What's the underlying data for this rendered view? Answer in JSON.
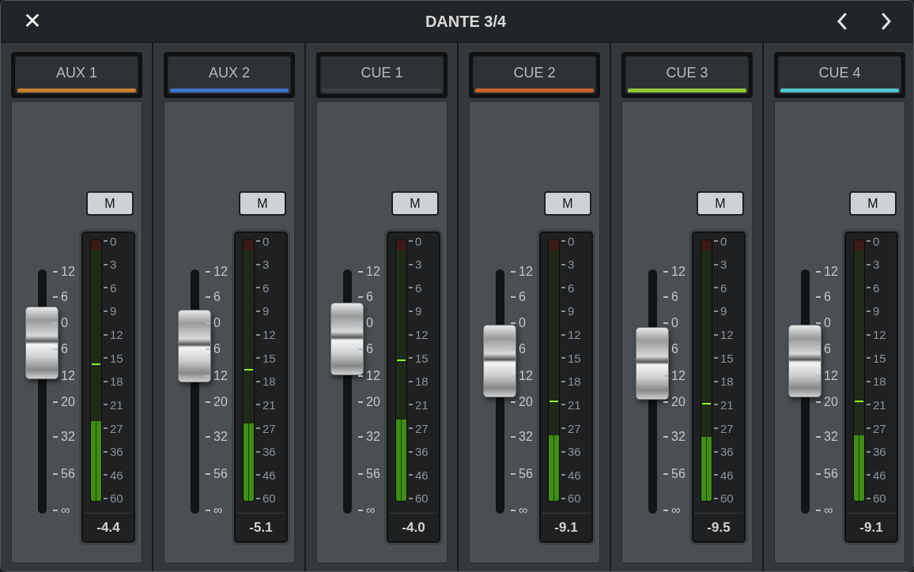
{
  "window": {
    "title": "DANTE 3/4",
    "close_icon": "✕"
  },
  "channels": [
    {
      "name": "AUX 1",
      "color": "#c4802f",
      "mute": {
        "label": "M",
        "muted": false
      },
      "fader": {
        "level": 0.7
      },
      "fader_scale": [
        "12",
        "6",
        "0",
        "6",
        "12",
        "20",
        "32",
        "56",
        "∞"
      ],
      "meter": {
        "level": 0.307
      },
      "peak": {
        "level": 0.52
      },
      "meter_scale": [
        "0",
        "3",
        "6",
        "9",
        "12",
        "15",
        "18",
        "21",
        "27",
        "36",
        "46",
        "60"
      ],
      "reading": "-4.4"
    },
    {
      "name": "AUX 2",
      "color": "#3a74c8",
      "mute": {
        "label": "M",
        "muted": false
      },
      "fader": {
        "level": 0.686
      },
      "fader_scale": [
        "12",
        "6",
        "0",
        "6",
        "12",
        "20",
        "32",
        "56",
        "∞"
      ],
      "meter": {
        "level": 0.298
      },
      "peak": {
        "level": 0.5
      },
      "meter_scale": [
        "0",
        "3",
        "6",
        "9",
        "12",
        "15",
        "18",
        "21",
        "27",
        "36",
        "46",
        "60"
      ],
      "reading": "-5.1"
    },
    {
      "name": "CUE 1",
      "color": "#3c3f42",
      "mute": {
        "label": "M",
        "muted": false
      },
      "fader": {
        "level": 0.715
      },
      "fader_scale": [
        "12",
        "6",
        "0",
        "6",
        "12",
        "20",
        "32",
        "56",
        "∞"
      ],
      "meter": {
        "level": 0.313
      },
      "peak": {
        "level": 0.535
      },
      "meter_scale": [
        "0",
        "3",
        "6",
        "9",
        "12",
        "15",
        "18",
        "21",
        "27",
        "36",
        "46",
        "60"
      ],
      "reading": "-4.0"
    },
    {
      "name": "CUE 2",
      "color": "#c9622a",
      "mute": {
        "label": "M",
        "muted": false
      },
      "fader": {
        "level": 0.625
      },
      "fader_scale": [
        "12",
        "6",
        "0",
        "6",
        "12",
        "20",
        "32",
        "56",
        "∞"
      ],
      "meter": {
        "level": 0.252
      },
      "peak": {
        "level": 0.38
      },
      "meter_scale": [
        "0",
        "3",
        "6",
        "9",
        "12",
        "15",
        "18",
        "21",
        "27",
        "36",
        "46",
        "60"
      ],
      "reading": "-9.1"
    },
    {
      "name": "CUE 3",
      "color": "#8fc63a",
      "mute": {
        "label": "M",
        "muted": false
      },
      "fader": {
        "level": 0.615
      },
      "fader_scale": [
        "12",
        "6",
        "0",
        "6",
        "12",
        "20",
        "32",
        "56",
        "∞"
      ],
      "meter": {
        "level": 0.246
      },
      "peak": {
        "level": 0.37
      },
      "meter_scale": [
        "0",
        "3",
        "6",
        "9",
        "12",
        "15",
        "18",
        "21",
        "27",
        "36",
        "46",
        "60"
      ],
      "reading": "-9.5"
    },
    {
      "name": "CUE 4",
      "color": "#4ec3c9",
      "mute": {
        "label": "M",
        "muted": false
      },
      "fader": {
        "level": 0.625
      },
      "fader_scale": [
        "12",
        "6",
        "0",
        "6",
        "12",
        "20",
        "32",
        "56",
        "∞"
      ],
      "meter": {
        "level": 0.252
      },
      "peak": {
        "level": 0.38
      },
      "meter_scale": [
        "0",
        "3",
        "6",
        "9",
        "12",
        "15",
        "18",
        "21",
        "27",
        "36",
        "46",
        "60"
      ],
      "reading": "-9.1"
    }
  ]
}
